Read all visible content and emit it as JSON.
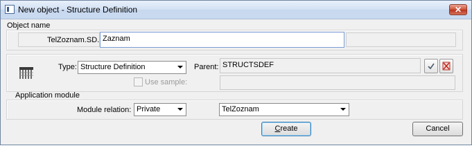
{
  "window": {
    "title": "New object - Structure Definition",
    "close_symbol": "✕"
  },
  "object_name": {
    "group_label": "Object name",
    "prefix_label": "TelZoznam.SD.",
    "name_value": "Zaznam"
  },
  "definition": {
    "type_label": "Type:",
    "type_value": "Structure Definition",
    "parent_label": "Parent:",
    "parent_value": "STRUCTSDEF",
    "use_sample_label": "Use sample:",
    "use_sample_checked": false,
    "icons": {
      "structure": "structure-definition-icon",
      "confirm": "checkmark-icon",
      "clear": "clear-icon"
    }
  },
  "application_module": {
    "group_label": "Application module",
    "relation_label": "Module relation:",
    "relation_value": "Private",
    "module_value": "TelZoznam"
  },
  "buttons": {
    "create_accel": "C",
    "create_rest": "reate",
    "cancel": "Cancel"
  }
}
